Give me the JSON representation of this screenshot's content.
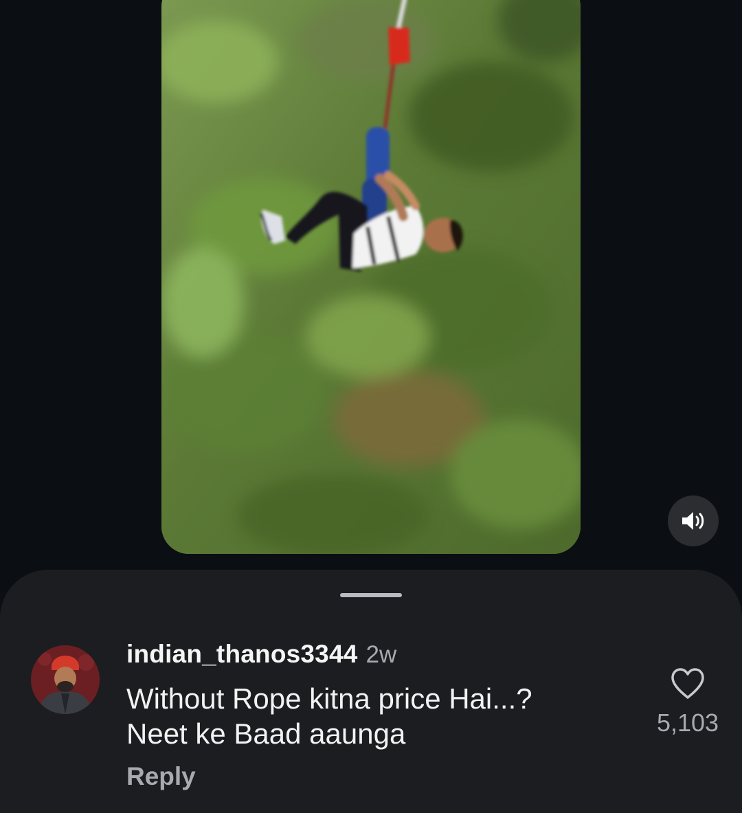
{
  "video": {
    "description_icon": "bungee-jump-video",
    "mute_icon": "speaker-sound-icon"
  },
  "comment": {
    "username": "indian_thanos3344",
    "timestamp": "2w",
    "text_line_1": "Without Rope kitna price Hai...?",
    "text_line_2": "Neet ke Baad aaunga",
    "reply_label": "Reply",
    "like_count": "5,103",
    "like_icon": "heart-outline-icon"
  },
  "colors": {
    "background": "#0b0e13",
    "sheet": "#1c1d21",
    "primary_text": "#f2f2f2",
    "secondary_text": "#a8aab0"
  }
}
